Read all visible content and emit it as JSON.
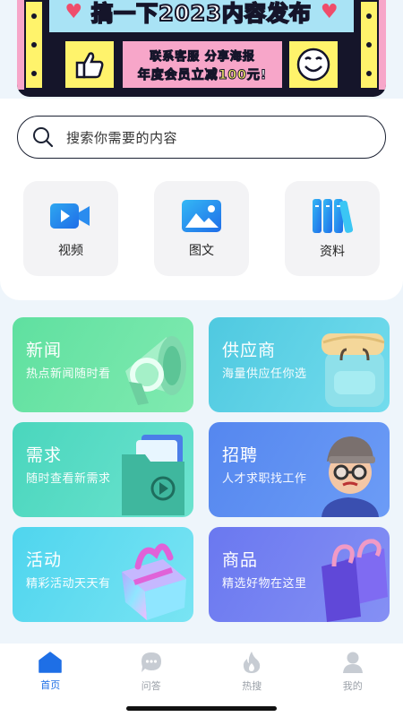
{
  "banner": {
    "title": "搞一下2023内容发布",
    "promo_line1": "联系客服 分享海报",
    "promo_line2_prefix": "年度会员立减",
    "promo_line2_amount": "100",
    "promo_line2_suffix": "元!"
  },
  "search": {
    "placeholder": "搜索你需要的内容",
    "icon": "search-icon"
  },
  "quick_links": [
    {
      "label": "视频",
      "icon": "video-icon"
    },
    {
      "label": "图文",
      "icon": "image-icon"
    },
    {
      "label": "资料",
      "icon": "books-icon"
    }
  ],
  "categories": [
    {
      "title": "新闻",
      "subtitle": "热点新闻随时看",
      "icon": "megaphone-icon",
      "color_from": "#5fe0a0",
      "color_to": "#7be8a8"
    },
    {
      "title": "供应商",
      "subtitle": "海量供应任你选",
      "icon": "backpack-icon",
      "color_from": "#59cfe0",
      "color_to": "#74dced"
    },
    {
      "title": "需求",
      "subtitle": "随时查看新需求",
      "icon": "folder-icon",
      "color_from": "#4fd8c0",
      "color_to": "#6be3cf"
    },
    {
      "title": "招聘",
      "subtitle": "人才求职找工作",
      "icon": "person-avatar-icon",
      "color_from": "#5b8ef2",
      "color_to": "#6c9cf6"
    },
    {
      "title": "活动",
      "subtitle": "精彩活动天天有",
      "icon": "gift-icon",
      "color_from": "#59d7ee",
      "color_to": "#74e1f1"
    },
    {
      "title": "商品",
      "subtitle": "精选好物在这里",
      "icon": "shopping-bag-icon",
      "color_from": "#6d7ef2",
      "color_to": "#8089f4"
    }
  ],
  "bottom_nav": [
    {
      "label": "首页",
      "icon": "home-icon",
      "active": true
    },
    {
      "label": "问答",
      "icon": "chat-bubble-icon",
      "active": false
    },
    {
      "label": "热搜",
      "icon": "flame-icon",
      "active": false
    },
    {
      "label": "我的",
      "icon": "user-icon",
      "active": false
    }
  ],
  "colors": {
    "accent": "#1e6fe6",
    "background": "#eef5fb",
    "nav_inactive": "#9aa0a8"
  }
}
